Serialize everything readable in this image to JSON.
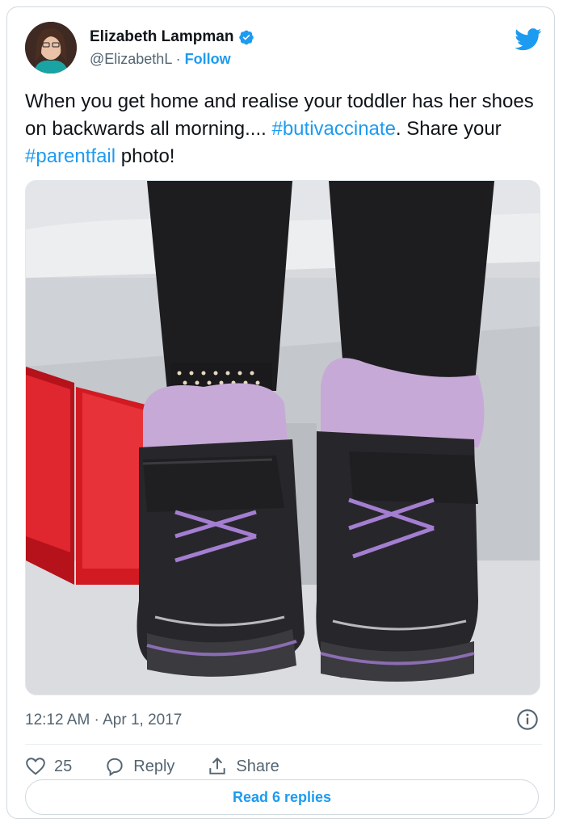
{
  "user": {
    "name": "Elizabeth Lampman",
    "handle": "@ElizabethL",
    "separator": " · ",
    "follow_label": "Follow"
  },
  "tweet": {
    "text_part1": "When you get home and realise your toddler has her shoes on backwards all morning.... ",
    "hashtag1": "#butivaccinate",
    "text_part2": ". Share your ",
    "hashtag2": "#parentfail",
    "text_part3": " photo!"
  },
  "meta": {
    "time": "12:12 AM · Apr 1, 2017"
  },
  "actions": {
    "like_count": "25",
    "reply_label": "Reply",
    "share_label": "Share"
  },
  "read_replies_label": "Read 6 replies",
  "colors": {
    "accent": "#1d9bf0",
    "text": "#0f1419",
    "muted": "#536471",
    "border": "#cfd9de"
  },
  "icons": [
    "verified-badge-icon",
    "twitter-bird-icon",
    "info-icon",
    "heart-icon",
    "reply-icon",
    "share-icon"
  ]
}
